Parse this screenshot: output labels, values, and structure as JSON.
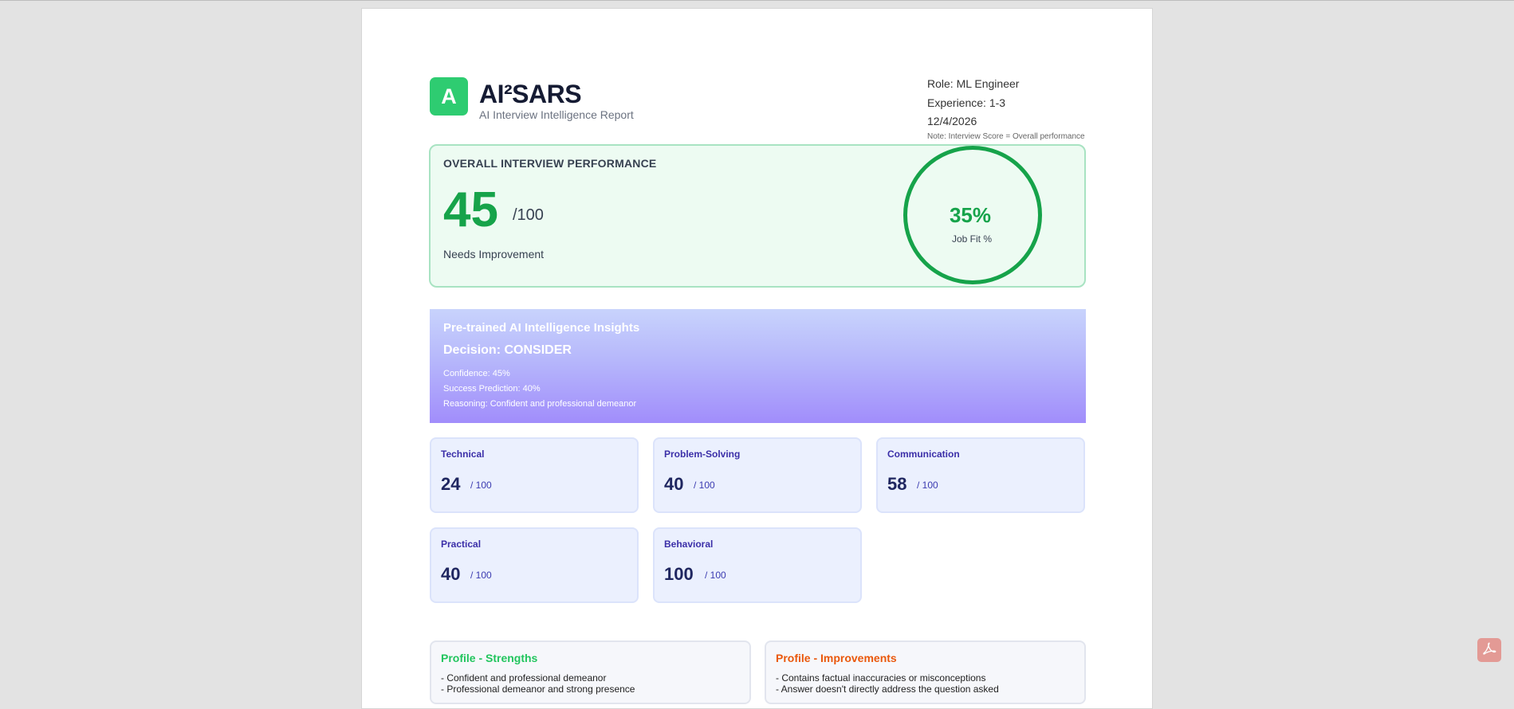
{
  "header": {
    "logo_letter": "A",
    "brand": "AI²SARS",
    "subtitle": "AI Interview Intelligence Report",
    "role": "Role: ML Engineer",
    "experience": "Experience: 1-3",
    "date": "12/4/2026",
    "note": "Note: Interview Score = Overall performance"
  },
  "overall": {
    "label": "OVERALL INTERVIEW PERFORMANCE",
    "score": "45",
    "max": "/100",
    "status": "Needs Improvement",
    "job_fit_value": "35%",
    "job_fit_label": "Job Fit %"
  },
  "ai_insights": {
    "title": "Pre-trained AI Intelligence Insights",
    "decision": "Decision: CONSIDER",
    "confidence": "Confidence: 45%",
    "success_prediction": "Success Prediction: 40%",
    "reasoning": "Reasoning: Confident and professional demeanor"
  },
  "scores": [
    {
      "name": "Technical",
      "value": "24",
      "max": "/ 100"
    },
    {
      "name": "Problem-Solving",
      "value": "40",
      "max": "/ 100"
    },
    {
      "name": "Communication",
      "value": "58",
      "max": "/ 100"
    },
    {
      "name": "Practical",
      "value": "40",
      "max": "/ 100"
    },
    {
      "name": "Behavioral",
      "value": "100",
      "max": "/ 100"
    }
  ],
  "profile": {
    "strengths_title": "Profile - Strengths",
    "strengths": [
      "- Confident and professional demeanor",
      "- Professional demeanor and strong presence"
    ],
    "improvements_title": "Profile - Improvements",
    "improvements": [
      "-  Contains factual inaccuracies or misconceptions",
      "-  Answer doesn't directly address the question asked"
    ]
  },
  "colors": {
    "accent_green": "#16a34a",
    "logo_green": "#2ecc71",
    "strengths_green": "#22c55e",
    "improvements_orange": "#ea580c",
    "card_title_indigo": "#3b2fa8"
  },
  "icons": {
    "floating": "acrobat-icon"
  }
}
